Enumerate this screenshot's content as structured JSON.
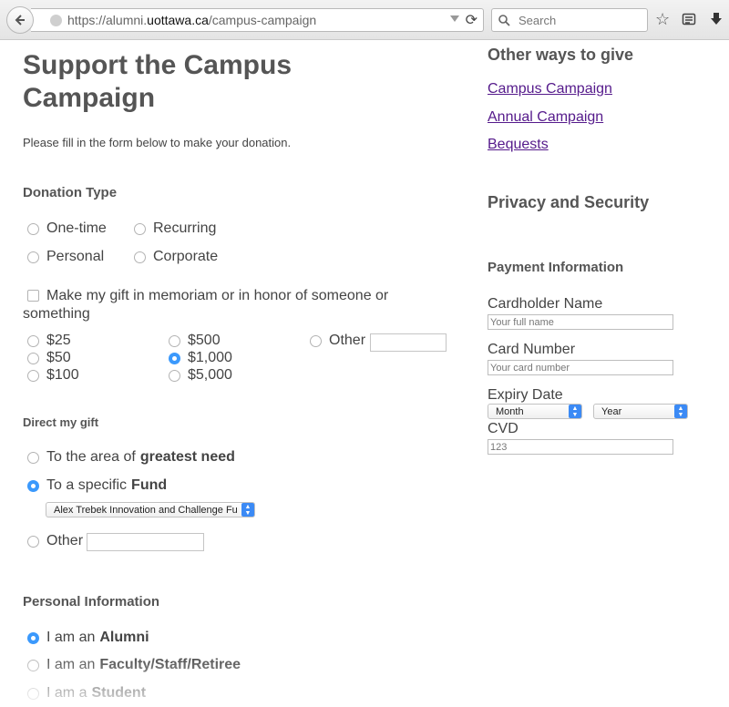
{
  "browser": {
    "url_prefix": "https://alumni.",
    "url_domain": "uottawa.ca",
    "url_path": "/campus-campaign",
    "search_placeholder": "Search"
  },
  "page": {
    "title_line1": "Support the Campus",
    "title_line2": "Campaign",
    "intro": "Please fill in the form below to make your donation."
  },
  "donation_type": {
    "heading": "Donation Type",
    "options": [
      "One-time",
      "Recurring",
      "Personal",
      "Corporate"
    ],
    "memoriam_label_line1": "Make my gift in memoriam or in honor of someone or",
    "memoriam_label_line2": "something"
  },
  "amounts": {
    "options": [
      "$25",
      "$50",
      "$100",
      "$500",
      "$1,000",
      "$5,000",
      "Other"
    ],
    "selected": "$1,000"
  },
  "direct_gift": {
    "heading": "Direct my gift",
    "greatest_prefix": "To the area of",
    "greatest_bold": "greatest need",
    "fund_prefix": "To a specific",
    "fund_bold": "Fund",
    "fund_selected": "Alex Trebek Innovation and Challenge Fu",
    "other_label": "Other"
  },
  "personal_info": {
    "heading": "Personal Information",
    "alumni_prefix": "I am an",
    "alumni_bold": "Alumni",
    "faculty_prefix": "I am an",
    "faculty_bold": "Faculty/Staff/Retiree",
    "student_prefix": "I am a",
    "student_bold": "Student"
  },
  "sidebar": {
    "other_ways_heading": "Other ways to give",
    "links": [
      "Campus Campaign",
      "Annual Campaign",
      "Bequests"
    ],
    "privacy_heading": "Privacy and Security",
    "payment_heading": "Payment Information",
    "cardholder_label": "Cardholder Name",
    "cardholder_placeholder": "Your full name",
    "card_number_label": "Card Number",
    "card_number_placeholder": "Your card number",
    "expiry_label": "Expiry Date",
    "month_value": "Month",
    "year_value": "Year",
    "cvd_label": "CVD",
    "cvd_placeholder": "123"
  },
  "colors": {
    "accent": "#3b99fc",
    "link_visited": "#551a8b",
    "heading": "#555555"
  }
}
